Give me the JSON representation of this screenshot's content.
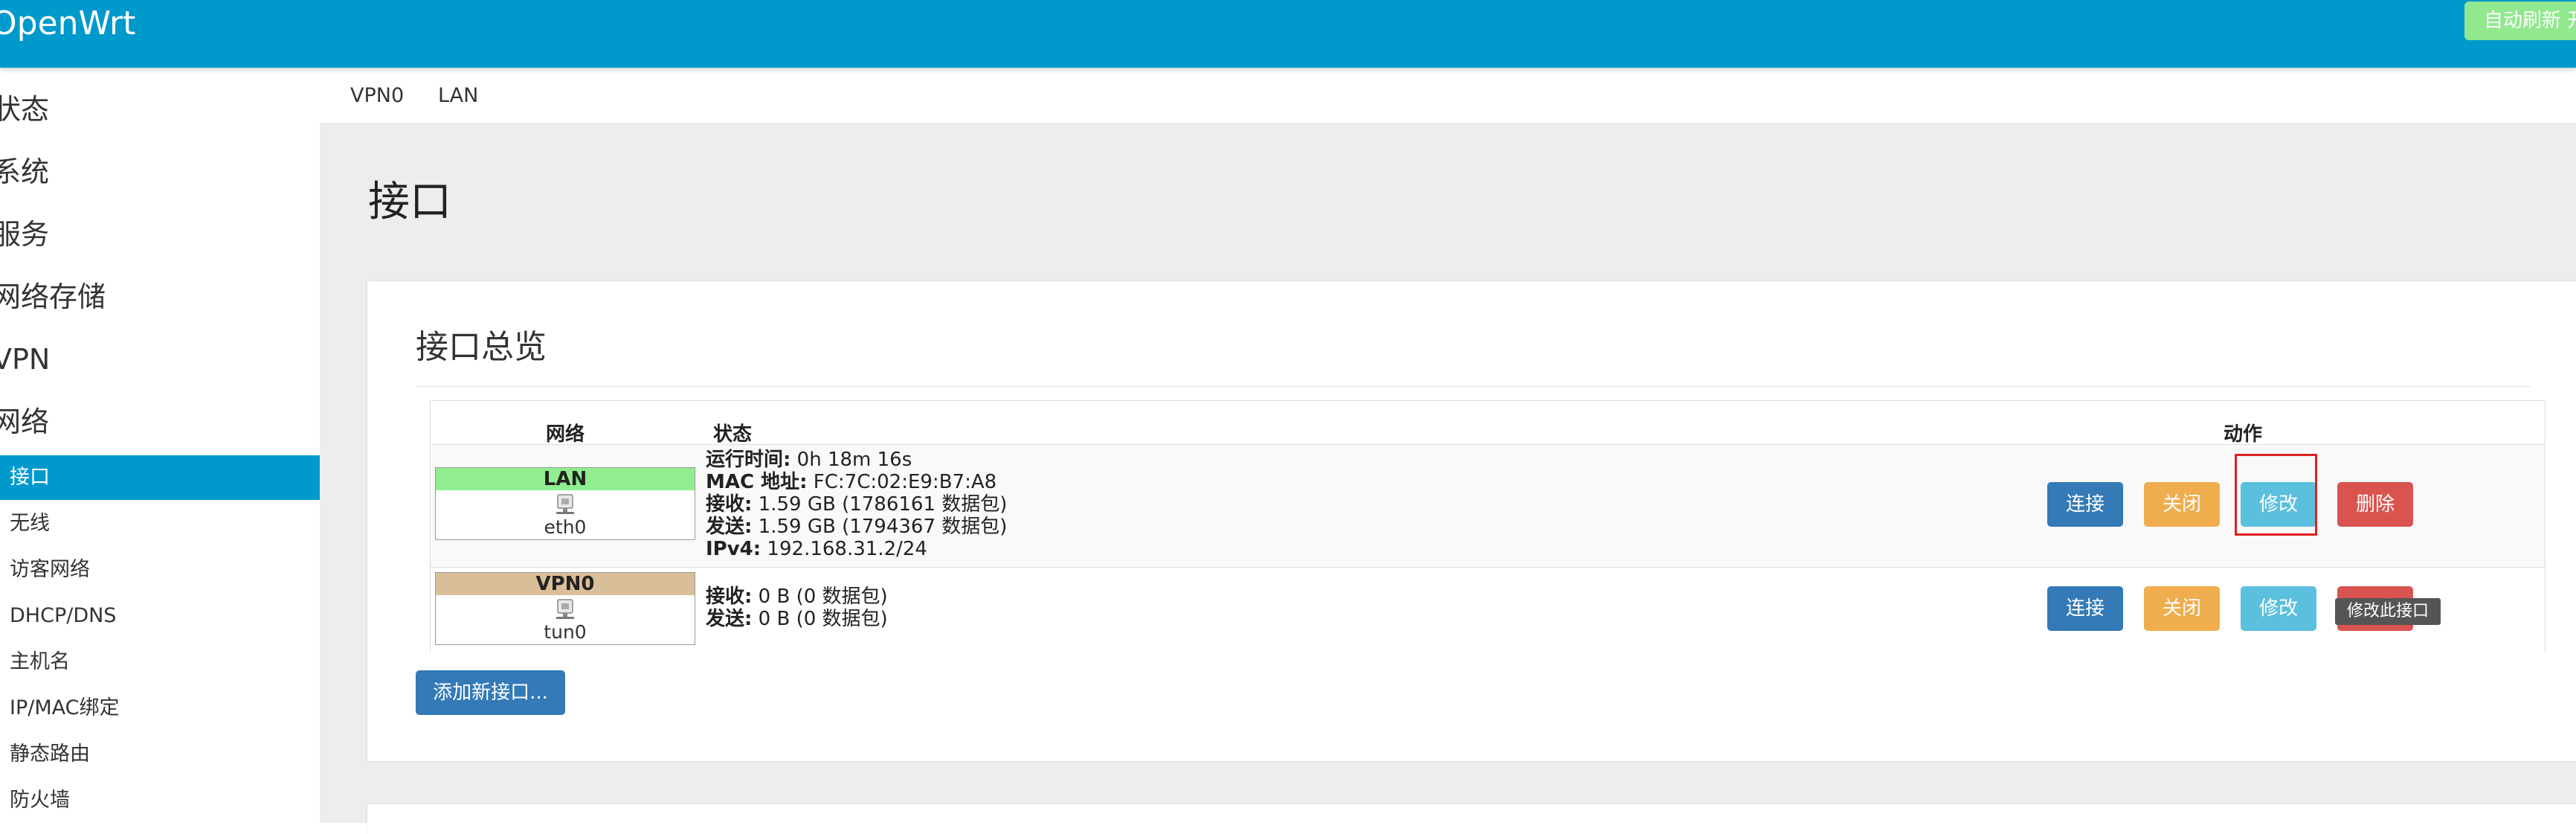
{
  "header": {
    "brand": "OpenWrt",
    "auto_refresh_label": "自动刷新 开",
    "colors": {
      "bar": "#0099cc",
      "refresh": "#91e88f"
    }
  },
  "sidebar": {
    "top_menus": [
      "状态",
      "系统",
      "服务",
      "网络存储",
      "VPN",
      "网络"
    ],
    "sub_items": [
      "接口",
      "无线",
      "访客网络",
      "DHCP/DNS",
      "主机名",
      "IP/MAC绑定",
      "静态路由",
      "防火墙"
    ],
    "active_item": "接口"
  },
  "tabs": [
    "VPN0",
    "LAN"
  ],
  "page_title": "接口",
  "overview": {
    "title": "接口总览",
    "columns": {
      "network": "网络",
      "status": "状态",
      "actions": "动作"
    },
    "rows": [
      {
        "name": "LAN",
        "device": "eth0",
        "badge_color": "#90ee90",
        "status": [
          {
            "label": "运行时间:",
            "value": " 0h 18m 16s"
          },
          {
            "label": "MAC 地址:",
            "value": " FC:7C:02:E9:B7:A8"
          },
          {
            "label": "接收:",
            "value": " 1.59 GB (1786161 数据包)"
          },
          {
            "label": "发送:",
            "value": " 1.59 GB (1794367 数据包)"
          },
          {
            "label": "IPv4:",
            "value": " 192.168.31.2/24"
          }
        ]
      },
      {
        "name": "VPN0",
        "device": "tun0",
        "badge_color": "#d9bf99",
        "status": [
          {
            "label": "接收:",
            "value": " 0 B (0 数据包)"
          },
          {
            "label": "发送:",
            "value": " 0 B (0 数据包)"
          }
        ]
      }
    ],
    "buttons": {
      "connect": "连接",
      "close": "关闭",
      "edit": "修改",
      "delete": "删除"
    },
    "tooltip": "修改此接口",
    "add_button": "添加新接口..."
  }
}
